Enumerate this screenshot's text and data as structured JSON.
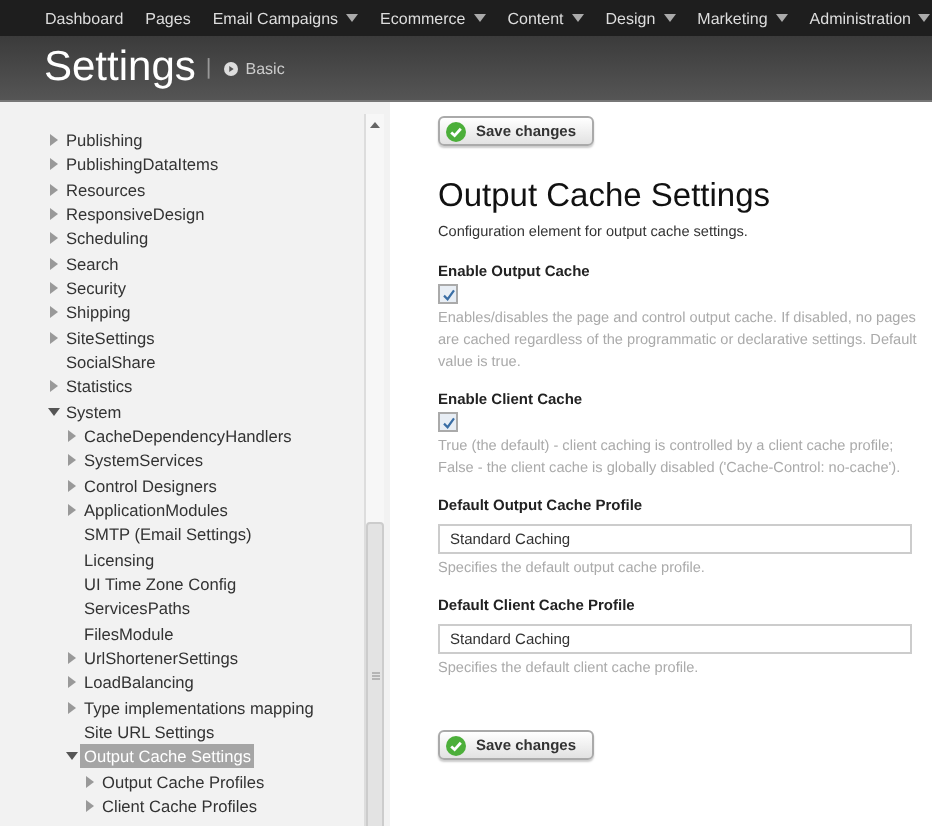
{
  "top_nav": {
    "items": [
      {
        "label": "Dashboard",
        "dropdown": false
      },
      {
        "label": "Pages",
        "dropdown": false
      },
      {
        "label": "Email Campaigns",
        "dropdown": true
      },
      {
        "label": "Ecommerce",
        "dropdown": true
      },
      {
        "label": "Content",
        "dropdown": true
      },
      {
        "label": "Design",
        "dropdown": true
      },
      {
        "label": "Marketing",
        "dropdown": true
      },
      {
        "label": "Administration",
        "dropdown": true
      }
    ]
  },
  "header": {
    "title": "Settings",
    "separator": "|",
    "mode_link": "Basic"
  },
  "sidebar": {
    "tree": [
      {
        "label": "Publishing",
        "kind": "branch",
        "expanded": false,
        "selected": false
      },
      {
        "label": "PublishingDataItems",
        "kind": "branch",
        "expanded": false,
        "selected": false
      },
      {
        "label": "Resources",
        "kind": "branch",
        "expanded": false,
        "selected": false
      },
      {
        "label": "ResponsiveDesign",
        "kind": "branch",
        "expanded": false,
        "selected": false
      },
      {
        "label": "Scheduling",
        "kind": "branch",
        "expanded": false,
        "selected": false
      },
      {
        "label": "Search",
        "kind": "branch",
        "expanded": false,
        "selected": false
      },
      {
        "label": "Security",
        "kind": "branch",
        "expanded": false,
        "selected": false
      },
      {
        "label": "Shipping",
        "kind": "branch",
        "expanded": false,
        "selected": false
      },
      {
        "label": "SiteSettings",
        "kind": "branch",
        "expanded": false,
        "selected": false
      },
      {
        "label": "SocialShare",
        "kind": "leaf",
        "selected": false
      },
      {
        "label": "Statistics",
        "kind": "branch",
        "expanded": false,
        "selected": false
      },
      {
        "label": "System",
        "kind": "branch",
        "expanded": true,
        "selected": false,
        "children": [
          {
            "label": "CacheDependencyHandlers",
            "kind": "branch",
            "expanded": false,
            "selected": false
          },
          {
            "label": "SystemServices",
            "kind": "branch",
            "expanded": false,
            "selected": false
          },
          {
            "label": "Control Designers",
            "kind": "branch",
            "expanded": false,
            "selected": false
          },
          {
            "label": "ApplicationModules",
            "kind": "branch",
            "expanded": false,
            "selected": false
          },
          {
            "label": "SMTP (Email Settings)",
            "kind": "leaf",
            "selected": false
          },
          {
            "label": "Licensing",
            "kind": "leaf",
            "selected": false
          },
          {
            "label": "UI Time Zone Config",
            "kind": "leaf",
            "selected": false
          },
          {
            "label": "ServicesPaths",
            "kind": "leaf",
            "selected": false
          },
          {
            "label": "FilesModule",
            "kind": "leaf",
            "selected": false
          },
          {
            "label": "UrlShortenerSettings",
            "kind": "branch",
            "expanded": false,
            "selected": false
          },
          {
            "label": "LoadBalancing",
            "kind": "branch",
            "expanded": false,
            "selected": false
          },
          {
            "label": "Type implementations mapping",
            "kind": "branch",
            "expanded": false,
            "selected": false
          },
          {
            "label": "Site URL Settings",
            "kind": "leaf",
            "selected": false
          },
          {
            "label": "Output Cache Settings",
            "kind": "branch",
            "expanded": true,
            "selected": true,
            "children": [
              {
                "label": "Output Cache Profiles",
                "kind": "branch",
                "expanded": false,
                "selected": false
              },
              {
                "label": "Client Cache Profiles",
                "kind": "branch",
                "expanded": false,
                "selected": false
              }
            ]
          }
        ]
      }
    ]
  },
  "main": {
    "save_button_top": "Save changes",
    "title": "Output Cache Settings",
    "description": "Configuration element for output cache settings.",
    "fields": [
      {
        "kind": "checkbox",
        "label": "Enable Output Cache",
        "checked": true,
        "help": "Enables/disables the page and control output cache. If disabled, no pages are cached regardless of the programmatic or declarative settings. Default value is true."
      },
      {
        "kind": "checkbox",
        "label": "Enable Client Cache",
        "checked": true,
        "help": "True (the default) - client caching is controlled by a client cache profile; False - the client cache is globally disabled ('Cache-Control: no-cache')."
      },
      {
        "kind": "text",
        "label": "Default Output Cache Profile",
        "value": "Standard Caching",
        "help": "Specifies the default output cache profile."
      },
      {
        "kind": "text",
        "label": "Default Client Cache Profile",
        "value": "Standard Caching",
        "help": "Specifies the default client cache profile."
      }
    ],
    "save_button_bottom": "Save changes"
  }
}
